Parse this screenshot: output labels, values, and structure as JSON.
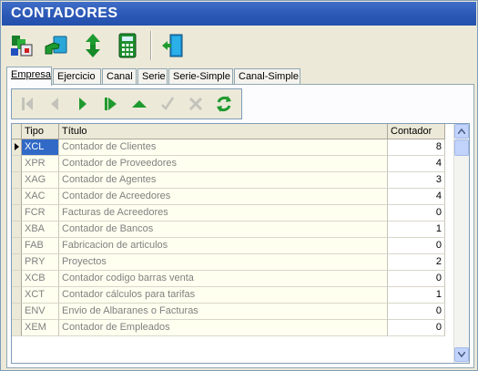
{
  "window": {
    "title": "CONTADORES"
  },
  "toolbar": {
    "buttons": [
      {
        "icon": "users-config-icon"
      },
      {
        "icon": "hand-card-icon"
      },
      {
        "icon": "up-down-arrows-icon"
      },
      {
        "icon": "calculator-icon"
      },
      {
        "icon": "exit-door-icon"
      }
    ]
  },
  "tabs": [
    {
      "label": "Empresa",
      "active": true
    },
    {
      "label": "Ejercicio"
    },
    {
      "label": "Canal"
    },
    {
      "label": "Serie"
    },
    {
      "label": "Serie-Simple"
    },
    {
      "label": "Canal-Simple"
    }
  ],
  "navigator": {
    "buttons": [
      "first-icon",
      "prior-icon",
      "next-icon",
      "last-icon",
      "insert-icon",
      "post-icon",
      "cancel-icon",
      "refresh-icon"
    ]
  },
  "grid": {
    "columns": {
      "tipo": "Tipo",
      "titulo": "Título",
      "contador": "Contador"
    },
    "rows": [
      {
        "tipo": "XCL",
        "titulo": "Contador de Clientes",
        "contador": "8"
      },
      {
        "tipo": "XPR",
        "titulo": "Contador de Proveedores",
        "contador": "4"
      },
      {
        "tipo": "XAG",
        "titulo": "Contador de Agentes",
        "contador": "3"
      },
      {
        "tipo": "XAC",
        "titulo": "Contador de Acreedores",
        "contador": "4"
      },
      {
        "tipo": "FCR",
        "titulo": "Facturas de Acreedores",
        "contador": "0"
      },
      {
        "tipo": "XBA",
        "titulo": "Contador de Bancos",
        "contador": "1"
      },
      {
        "tipo": "FAB",
        "titulo": "Fabricacion de articulos",
        "contador": "0"
      },
      {
        "tipo": "PRY",
        "titulo": "Proyectos",
        "contador": "2"
      },
      {
        "tipo": "XCB",
        "titulo": "Contador codigo barras venta",
        "contador": "0"
      },
      {
        "tipo": "XCT",
        "titulo": "Contador cálculos para tarifas",
        "contador": "1"
      },
      {
        "tipo": "ENV",
        "titulo": "Envio de Albaranes o Facturas",
        "contador": "0"
      },
      {
        "tipo": "XEM",
        "titulo": "Contador de Empleados",
        "contador": "0"
      }
    ]
  },
  "colors": {
    "titlebar": "#2a56b5",
    "selection": "#3169c6",
    "nav_green": "#1f9a2e",
    "readonly_cell": "#fffff0"
  }
}
